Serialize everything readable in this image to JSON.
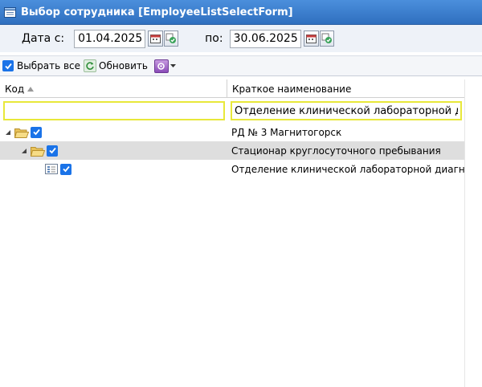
{
  "window": {
    "title": "Выбор сотрудника [EmployeeListSelectForm]"
  },
  "dates": {
    "from_label": "Дата с:",
    "from_value": "01.04.2025",
    "to_label": "по:",
    "to_value": "30.06.2025"
  },
  "toolbar": {
    "select_all_label": "Выбрать все",
    "refresh_label": "Обновить"
  },
  "grid": {
    "columns": [
      {
        "label": "Код"
      },
      {
        "label": "Краткое наименование"
      }
    ],
    "filters": {
      "code_value": "",
      "name_value": "Отделение клинической лабораторной диагностики"
    },
    "rows": [
      {
        "level": 0,
        "name": "РД № 3 Магнитогорск"
      },
      {
        "level": 1,
        "name": "Стационар круглосуточного пребывания"
      },
      {
        "level": 2,
        "name": "Отделение клинической лабораторной диагностики"
      }
    ]
  },
  "colors": {
    "title_bar": "#3a7fd0",
    "checkbox": "#1a73e8",
    "filter_border": "#e8e83a",
    "selected_row": "#dedede"
  }
}
